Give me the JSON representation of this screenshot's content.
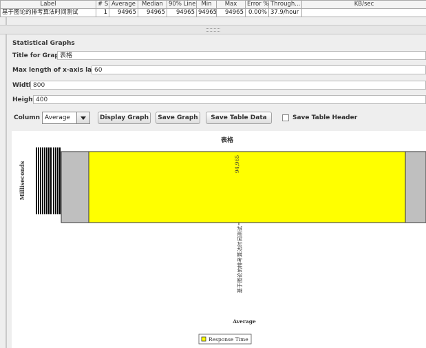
{
  "summary_table": {
    "headers": [
      "Label",
      "# S...",
      "Average",
      "Median",
      "90% Line",
      "Min",
      "Max",
      "Error %",
      "Through...",
      "KB/sec"
    ],
    "rows": [
      [
        "基于图论的排考算法时间测试",
        "1",
        "94965",
        "94965",
        "94965",
        "94965",
        "94965",
        "0.00%",
        "37.9/hour",
        ""
      ]
    ]
  },
  "stat_graphs": {
    "section_title": "Statistical Graphs",
    "title_label": "Title for Graph",
    "title_value": "表格",
    "maxlen_label": "Max length of x-axis label",
    "maxlen_value": "60",
    "width_label": "Width",
    "width_value": "800",
    "height_label": "Height",
    "height_value": "400",
    "column_label": "Column",
    "column_selected": "Average",
    "display_graph_btn": "Display Graph",
    "save_graph_btn": "Save Graph",
    "save_table_btn": "Save Table Data",
    "save_header_label": "Save Table Header",
    "save_header_checked": false
  },
  "chart_data": {
    "type": "bar",
    "title": "表格",
    "xlabel": "Average",
    "ylabel": "Milliseconds",
    "categories": [
      "基于图论的排考算法时间测试"
    ],
    "series": [
      {
        "name": "Response Time",
        "values": [
          94965
        ]
      }
    ],
    "data_labels": [
      "94,965"
    ],
    "bar_color": "#ffff00",
    "plot_bg": "#bfbfbf",
    "legend_position": "bottom-center",
    "grid": false
  }
}
